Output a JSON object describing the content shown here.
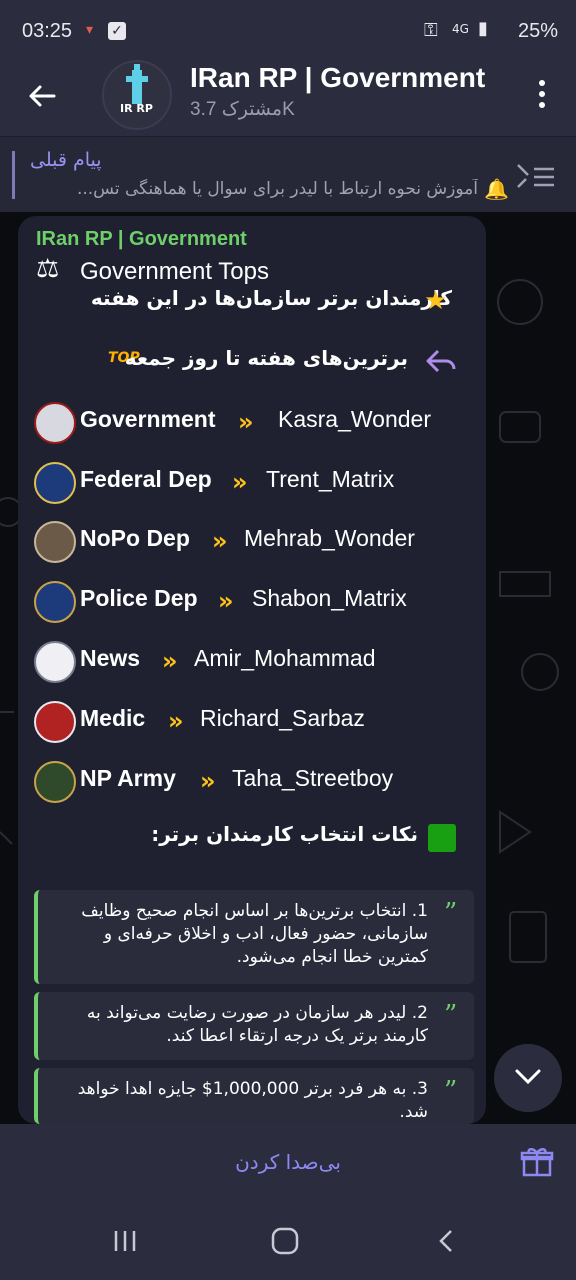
{
  "status": {
    "time": "03:25",
    "battery": "25%"
  },
  "header": {
    "title": "IRan RP | Government",
    "subscribers": "مشترک 3.7K",
    "avatar_text": "IR RP"
  },
  "pinned": {
    "title": "پیام قبلی",
    "text": "آموزش نحوه ارتباط با لیدر برای سوال یا هماهنگی تس..."
  },
  "message": {
    "channel_name": "IRan RP | Government",
    "heading": "Government Tops",
    "subheading": "کارمندان برتر سازمان‌ها در این هفته",
    "week_label": "برترین‌های هفته تا روز جمعه",
    "top_badge": "TOP",
    "rows": [
      {
        "dept": "Government",
        "name": "Kasra_Wonder"
      },
      {
        "dept": "Federal Dep",
        "name": "Trent_Matrix"
      },
      {
        "dept": "NoPo Dep",
        "name": "Mehrab_Wonder"
      },
      {
        "dept": "Police Dep",
        "name": "Shabon_Matrix"
      },
      {
        "dept": "News",
        "name": "Amir_Mohammad"
      },
      {
        "dept": "Medic",
        "name": "Richard_Sarbaz"
      },
      {
        "dept": "NP Army",
        "name": "Taha_Streetboy"
      }
    ],
    "notes_title": "نکات انتخاب کارمندان برتر:",
    "quotes": [
      "1. انتخاب برترین‌ها بر اساس انجام صحیح وظایف سازمانی، حضور فعال، ادب و اخلاق حرفه‌ای و کمترین خطا انجام می‌شود.",
      "2. لیدر هر سازمان در صورت رضایت می‌تواند به کارمند برتر یک درجه ارتقاء اعطا کند.",
      "3. به هر فرد برتر 1,000,000$ جایزه اهدا خواهد شد."
    ]
  },
  "bottom": {
    "mute_label": "بی‌صدا کردن"
  },
  "colors": {
    "accent": "#8e88f2",
    "channel_green": "#6fcf6a",
    "arrow_yellow": "#ffc21a"
  }
}
